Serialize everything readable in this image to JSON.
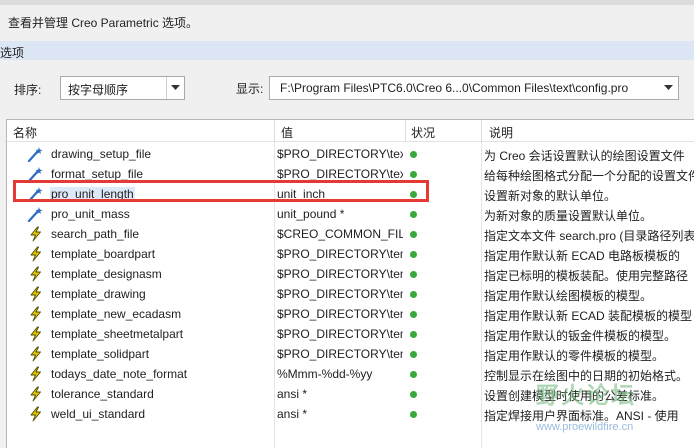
{
  "description": "查看并管理 Creo Parametric 选项。",
  "section": {
    "label": "选项"
  },
  "sort": {
    "label": "排序:",
    "value": "按字母顺序"
  },
  "show": {
    "label": "显示:",
    "value": "F:\\Program Files\\PTC6.0\\Creo 6...0\\Common Files\\text\\config.pro"
  },
  "table": {
    "headers": {
      "name": "名称",
      "value": "值",
      "status": "状况",
      "note": "说明"
    },
    "rows": [
      {
        "name": "drawing_setup_file",
        "value": "$PRO_DIRECTORY\\text",
        "note": "为 Creo 会话设置默认的绘图设置文件",
        "icon": "wand-icon"
      },
      {
        "name": "format_setup_file",
        "value": "$PRO_DIRECTORY\\text",
        "note": "给每种绘图格式分配一个分配的设置文件",
        "icon": "wand-icon"
      },
      {
        "name": "pro_unit_length",
        "value": "unit_inch",
        "note": "设置新对象的默认单位。",
        "icon": "wand-icon",
        "selected": true
      },
      {
        "name": "pro_unit_mass",
        "value": "unit_pound *",
        "note": "为新对象的质量设置默认单位。",
        "icon": "wand-icon"
      },
      {
        "name": "search_path_file",
        "value": "$CREO_COMMON_FILES",
        "note": "指定文本文件 search.pro (目录路径列表)",
        "icon": "lightning-icon"
      },
      {
        "name": "template_boardpart",
        "value": "$PRO_DIRECTORY\\templates",
        "note": "指定用作默认新 ECAD 电路板模板的",
        "icon": "lightning-icon"
      },
      {
        "name": "template_designasm",
        "value": "$PRO_DIRECTORY\\templates",
        "note": "指定已标明的模板装配。使用完整路径",
        "icon": "lightning-icon"
      },
      {
        "name": "template_drawing",
        "value": "$PRO_DIRECTORY\\templates",
        "note": "指定用作默认绘图模板的模型。",
        "icon": "lightning-icon"
      },
      {
        "name": "template_new_ecadasm",
        "value": "$PRO_DIRECTORY\\templates",
        "note": "指定用作默认新 ECAD 装配模板的模型",
        "icon": "lightning-icon"
      },
      {
        "name": "template_sheetmetalpart",
        "value": "$PRO_DIRECTORY\\templates",
        "note": "指定用作默认的钣金件模板的模型。",
        "icon": "lightning-icon"
      },
      {
        "name": "template_solidpart",
        "value": "$PRO_DIRECTORY\\templates",
        "note": "指定用作默认的零件模板的模型。",
        "icon": "lightning-icon"
      },
      {
        "name": "todays_date_note_format",
        "value": "%Mmm-%dd-%yy",
        "note": "控制显示在绘图中的日期的初始格式。",
        "icon": "lightning-icon"
      },
      {
        "name": "tolerance_standard",
        "value": "ansi *",
        "note": "设置创建模型时使用的公差标准。",
        "icon": "lightning-icon"
      },
      {
        "name": "weld_ui_standard",
        "value": "ansi *",
        "note": "指定焊接用户界面标准。ANSI - 使用",
        "icon": "lightning-icon"
      }
    ]
  },
  "watermark": {
    "text": "野火论坛",
    "url": "www.proewildfire.cn"
  },
  "colors": {
    "highlight": "#e53935",
    "status": "#3aa83a",
    "section_bar": "#dce6f4"
  }
}
